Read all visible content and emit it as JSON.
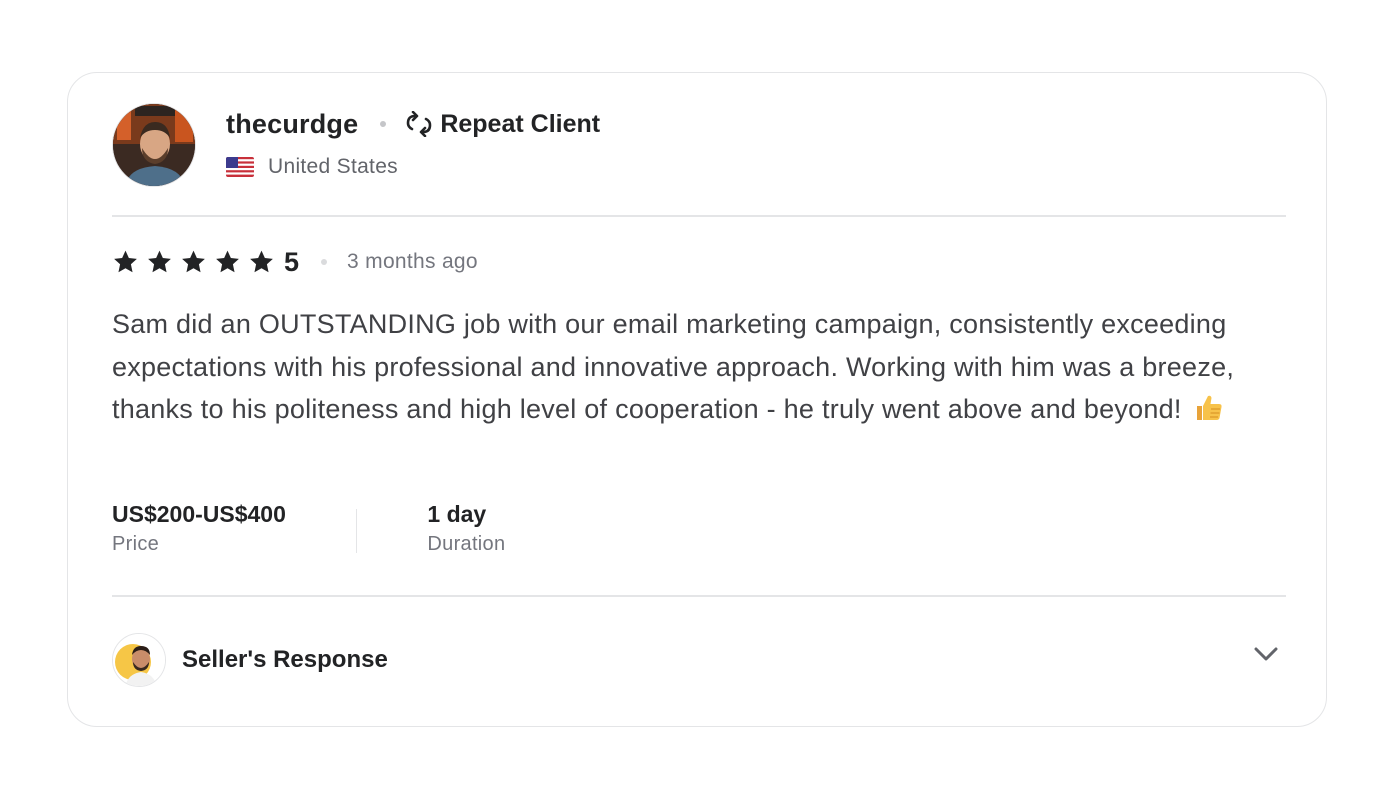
{
  "review": {
    "username": "thecurdge",
    "badge": {
      "label": "Repeat Client",
      "icon": "repeat-icon"
    },
    "country": "United States",
    "flag_icon": "us-flag-icon",
    "rating": {
      "value": "5",
      "stars": 5,
      "max": 5
    },
    "time_ago": "3 months ago",
    "text": "Sam did an OUTSTANDING job with our email marketing campaign, consistently exceeding expectations with his professional and innovative approach. Working with him was a breeze, thanks to his politeness and high level of cooperation - he truly went above and beyond!",
    "emoji_icon": "thumbs-up-icon",
    "price": {
      "value": "US$200-US$400",
      "label": "Price"
    },
    "duration": {
      "value": "1 day",
      "label": "Duration"
    },
    "seller_response": {
      "label": "Seller's Response",
      "expanded": false
    }
  },
  "colors": {
    "text_primary": "#222325",
    "text_body": "#404145",
    "text_muted": "#74767e",
    "border": "#e4e5e7",
    "star": "#222325"
  }
}
